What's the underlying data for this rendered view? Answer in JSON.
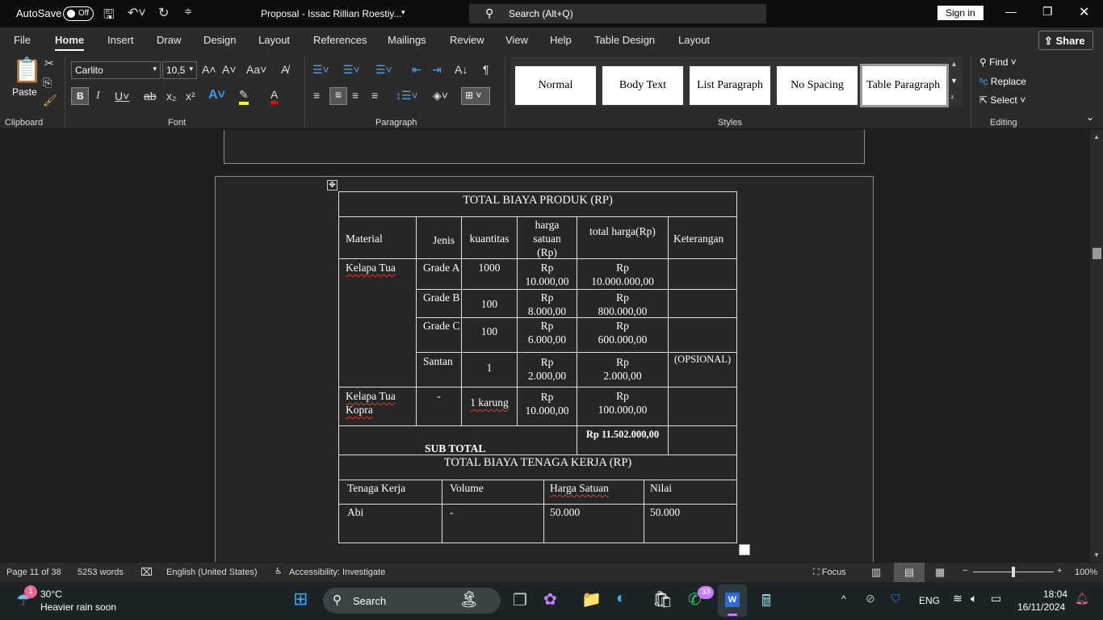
{
  "titlebar": {
    "autosave": "AutoSave",
    "autosave_state": "Off",
    "doc_title": "Proposal - Issac Rillian Roestiy...",
    "search": "Search (Alt+Q)",
    "sign_in": "Sign in"
  },
  "tabs": [
    "File",
    "Home",
    "Insert",
    "Draw",
    "Design",
    "Layout",
    "References",
    "Mailings",
    "Review",
    "View",
    "Help",
    "Table Design",
    "Layout"
  ],
  "share": "Share",
  "ribbon": {
    "paste": "Paste",
    "font_name": "Carlito",
    "font_size": "10,5",
    "groups": {
      "clipboard": "Clipboard",
      "font": "Font",
      "paragraph": "Paragraph",
      "styles": "Styles",
      "editing": "Editing"
    },
    "styles": [
      "Normal",
      "Body Text",
      "List Paragraph",
      "No Spacing",
      "Table Paragraph"
    ],
    "editing": {
      "find": "Find",
      "replace": "Replace",
      "select": "Select"
    },
    "colors": {
      "highlight": "#ffff00",
      "font_color": "#ff0000"
    }
  },
  "table1": {
    "title": "TOTAL BIAYA PRODUK (RP)",
    "headers": [
      "Material",
      "Jenis",
      "kuantitas",
      "harga satuan (Rp)",
      "total harga(Rp)",
      "Keterangan"
    ],
    "rows": [
      {
        "material": "Kelapa Tua",
        "jenis": "Grade A",
        "qty": "1000",
        "price": "Rp 10.000,00",
        "total": "Rp 10.000.000,00",
        "note": ""
      },
      {
        "jenis": "Grade B",
        "qty": "100",
        "price": "Rp 8.000,00",
        "total": "Rp 800.000,00",
        "note": ""
      },
      {
        "jenis": "Grade C",
        "qty": "100",
        "price": "Rp 6.000,00",
        "total": "Rp 600.000,00",
        "note": ""
      },
      {
        "jenis": "Santan",
        "qty": "1",
        "price": "Rp 2.000,00",
        "total": "Rp 2.000,00",
        "note": "(OPSIONAL)"
      },
      {
        "material": "Kelapa Tua Kopra",
        "jenis": "-",
        "qty": "1 karung",
        "price": "Rp 10.000,00",
        "total": "Rp 100.000,00",
        "note": ""
      }
    ],
    "subtotal_label": "SUB TOTAL",
    "subtotal_value": "Rp 11.502.000,00"
  },
  "table2": {
    "title": "TOTAL BIAYA TENAGA KERJA (RP)",
    "headers": [
      "Tenaga Kerja",
      "Volume",
      "Harga Satuan",
      "Nilai"
    ],
    "rows": [
      {
        "name": "Abi",
        "volume": "-",
        "price": "50.000",
        "value": "50.000"
      }
    ]
  },
  "status": {
    "page": "Page 11 of 38",
    "words": "5253 words",
    "language": "English (United States)",
    "accessibility": "Accessibility: Investigate",
    "focus": "Focus",
    "zoom": "100%",
    "zoom_level": 100
  },
  "taskbar": {
    "weather_temp": "30°C",
    "weather_text": "Heavier rain soon",
    "weather_badge": "1",
    "search": "Search",
    "whatsapp_badge": "33",
    "lang": "ENG",
    "time": "18:04",
    "date": "16/11/2024"
  }
}
